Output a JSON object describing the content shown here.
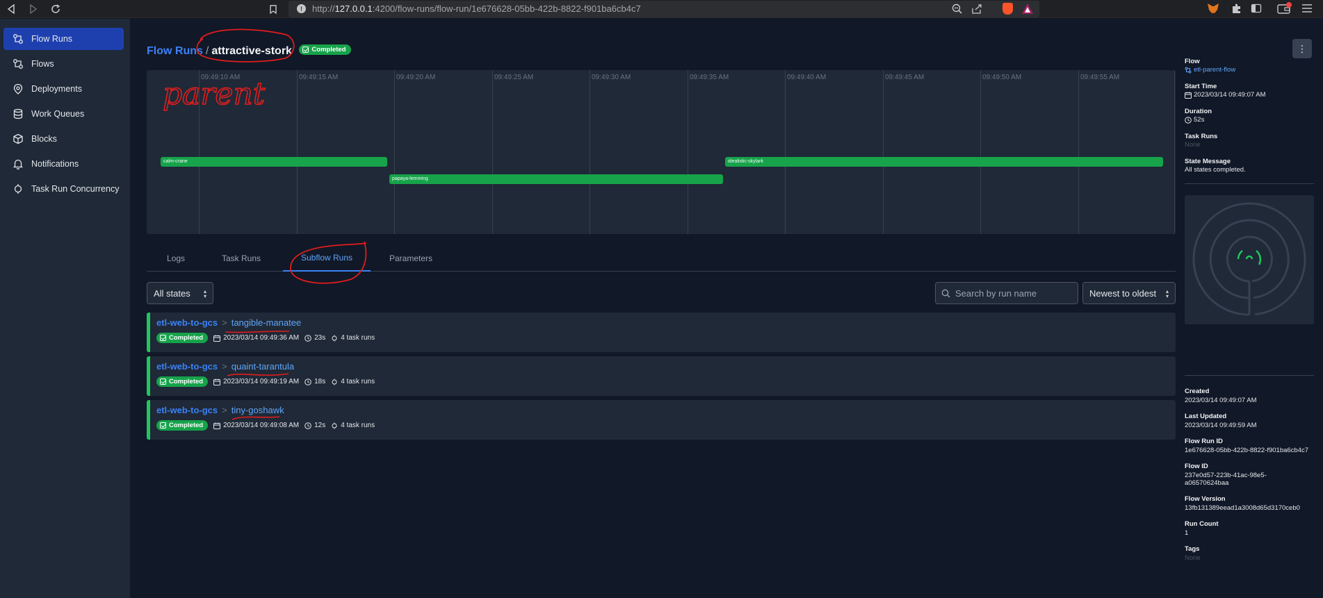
{
  "browser": {
    "url_prefix": "http://",
    "url_host": "127.0.0.1",
    "url_path": ":4200/flow-runs/flow-run/1e676628-05bb-422b-8822-f901ba6cb4c7"
  },
  "sidebar": {
    "items": [
      {
        "label": "Flow Runs",
        "icon": "flow-runs-icon",
        "active": true
      },
      {
        "label": "Flows",
        "icon": "flows-icon",
        "active": false
      },
      {
        "label": "Deployments",
        "icon": "deployments-icon",
        "active": false
      },
      {
        "label": "Work Queues",
        "icon": "work-queues-icon",
        "active": false
      },
      {
        "label": "Blocks",
        "icon": "blocks-icon",
        "active": false
      },
      {
        "label": "Notifications",
        "icon": "bell-icon",
        "active": false
      },
      {
        "label": "Task Run Concurrency",
        "icon": "concurrency-icon",
        "active": false
      }
    ]
  },
  "header": {
    "breadcrumb_link": "Flow Runs",
    "separator": "/",
    "run_name": "attractive-stork",
    "state": "Completed",
    "annotation_text": "parent"
  },
  "timeline": {
    "ticks": [
      "09:49:10 AM",
      "09:49:15 AM",
      "09:49:20 AM",
      "09:49:25 AM",
      "09:49:30 AM",
      "09:49:35 AM",
      "09:49:40 AM",
      "09:49:45 AM",
      "09:49:50 AM",
      "09:49:55 AM"
    ],
    "bars": [
      {
        "label": "calm-crane"
      },
      {
        "label": "papaya-lemming"
      },
      {
        "label": "idealistic-skylark"
      }
    ]
  },
  "tabs": [
    "Logs",
    "Task Runs",
    "Subflow Runs",
    "Parameters"
  ],
  "active_tab": "Subflow Runs",
  "filters": {
    "state": "All states",
    "search_placeholder": "Search by run name",
    "sort": "Newest to oldest"
  },
  "subflow_runs": [
    {
      "flow": "etl-web-to-gcs",
      "sep": ">",
      "run": "tangible-manatee",
      "state": "Completed",
      "start": "2023/03/14 09:49:36 AM",
      "duration": "23s",
      "tasks": "4 task runs"
    },
    {
      "flow": "etl-web-to-gcs",
      "sep": ">",
      "run": "quaint-tarantula",
      "state": "Completed",
      "start": "2023/03/14 09:49:19 AM",
      "duration": "18s",
      "tasks": "4 task runs"
    },
    {
      "flow": "etl-web-to-gcs",
      "sep": ">",
      "run": "tiny-goshawk",
      "state": "Completed",
      "start": "2023/03/14 09:49:08 AM",
      "duration": "12s",
      "tasks": "4 task runs"
    }
  ],
  "details": {
    "flow_label": "Flow",
    "flow_value": "etl-parent-flow",
    "start_label": "Start Time",
    "start_value": "2023/03/14 09:49:07 AM",
    "duration_label": "Duration",
    "duration_value": "52s",
    "task_runs_label": "Task Runs",
    "task_runs_value": "None",
    "state_msg_label": "State Message",
    "state_msg_value": "All states completed.",
    "created_label": "Created",
    "created_value": "2023/03/14 09:49:07 AM",
    "updated_label": "Last Updated",
    "updated_value": "2023/03/14 09:49:59 AM",
    "run_id_label": "Flow Run ID",
    "run_id_value": "1e676628-05bb-422b-8822-f901ba6cb4c7",
    "flow_id_label": "Flow ID",
    "flow_id_value_1": "237e0d57-223b-41ac-98e5-",
    "flow_id_value_2": "a06570624baa",
    "version_label": "Flow Version",
    "version_value": "13fb131389eead1a3008d65d3170ceb0",
    "run_count_label": "Run Count",
    "run_count_value": "1",
    "tags_label": "Tags",
    "tags_value": "None"
  },
  "colors": {
    "accent": "#1e40af",
    "completed": "#16a34a",
    "link": "#3b82f6",
    "annotation": "#e11d1d"
  }
}
